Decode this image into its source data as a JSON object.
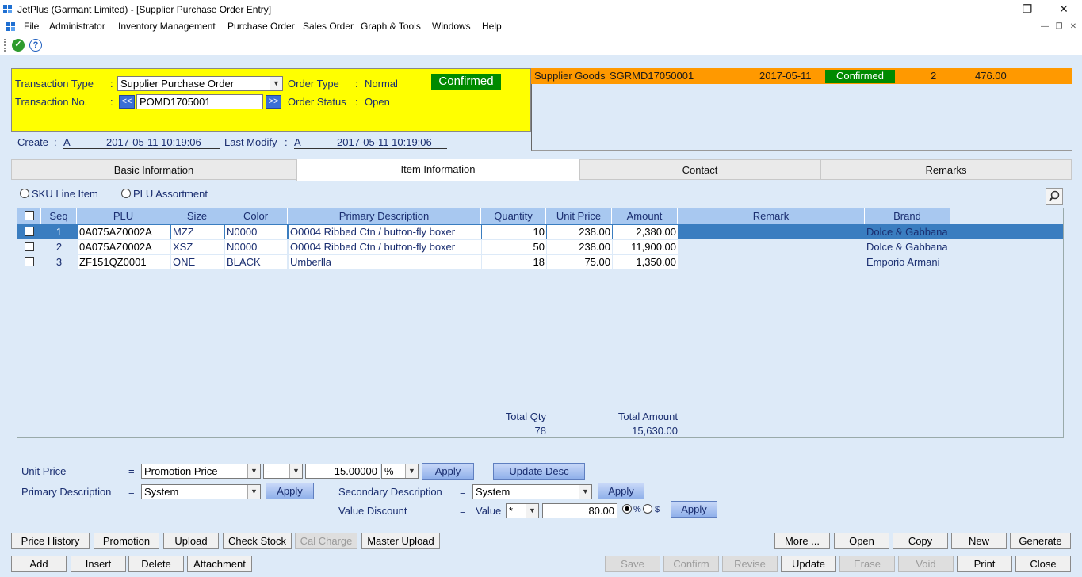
{
  "window": {
    "title": "JetPlus (Garmant Limited) - [Supplier Purchase Order Entry]",
    "min": "—",
    "restore": "❐",
    "close": "✕"
  },
  "menu": [
    "File",
    "Administrator",
    "Inventory Management",
    "Purchase Order",
    "Sales Order",
    "Graph & Tools",
    "Windows",
    "Help"
  ],
  "mdi": {
    "min": "—",
    "restore": "❐",
    "close": "✕"
  },
  "header": {
    "transaction_type_label": "Transaction Type",
    "transaction_type_value": "Supplier Purchase Order",
    "order_type_label": "Order Type",
    "order_type_value": "Normal",
    "status_badge": "Confirmed",
    "transaction_no_label": "Transaction No.",
    "transaction_no_value": "POMD1705001",
    "prev": "<<",
    "next": ">>",
    "order_status_label": "Order Status",
    "order_status_value": "Open",
    "colon": ":",
    "create_label": "Create",
    "create_user": "A",
    "create_time": "2017-05-11 10:19:06",
    "modify_label": "Last Modify",
    "modify_user": "A",
    "modify_time": "2017-05-11 10:19:06"
  },
  "related": {
    "type": "Supplier Goods",
    "doc_no": "SGRMD17050001",
    "date": "2017-05-11",
    "status": "Confirmed",
    "qty": "2",
    "amount": "476.00"
  },
  "tabs": [
    "Basic Information",
    "Item Information",
    "Contact",
    "Remarks"
  ],
  "view_options": {
    "sku": "SKU Line Item",
    "plu": "PLU Assortment"
  },
  "grid": {
    "columns": [
      "Seq",
      "PLU",
      "Size",
      "Color",
      "Primary Description",
      "Quantity",
      "Unit Price",
      "Amount",
      "Remark",
      "Brand"
    ],
    "rows": [
      {
        "seq": "1",
        "plu": "0A075AZ0002A",
        "size": "MZZ",
        "color": "N0000",
        "desc": "O0004   Ribbed Ctn / button-fly boxer",
        "qty": "10",
        "price": "238.00",
        "amount": "2,380.00",
        "remark": "",
        "brand": "Dolce & Gabbana"
      },
      {
        "seq": "2",
        "plu": "0A075AZ0002A",
        "size": "XSZ",
        "color": "N0000",
        "desc": "O0004   Ribbed Ctn / button-fly boxer",
        "qty": "50",
        "price": "238.00",
        "amount": "11,900.00",
        "remark": "",
        "brand": "Dolce & Gabbana"
      },
      {
        "seq": "3",
        "plu": "ZF151QZ0001",
        "size": "ONE",
        "color": "BLACK",
        "desc": "Umberlla",
        "qty": "18",
        "price": "75.00",
        "amount": "1,350.00",
        "remark": "",
        "brand": "Emporio Armani"
      }
    ],
    "total_qty_label": "Total Qty",
    "total_qty": "78",
    "total_amount_label": "Total Amount",
    "total_amount": "15,630.00"
  },
  "bulk": {
    "unit_price_label": "Unit Price",
    "eq": "=",
    "unit_price_mode": "Promotion Price",
    "op": "-",
    "unit_price_value": "15.00000",
    "unit": "%",
    "apply": "Apply",
    "update_desc": "Update Desc",
    "primary_desc_label": "Primary Description",
    "primary_desc_value": "System",
    "secondary_desc_label": "Secondary Description",
    "secondary_desc_value": "System",
    "value_discount_label": "Value Discount",
    "value_label": "Value",
    "value_op": "*",
    "value_amount": "80.00",
    "pct": "%",
    "dollar": "$"
  },
  "buttons_row1": [
    "Price History",
    "Promotion",
    "Upload",
    "Check Stock",
    "Cal Charge",
    "Master Upload"
  ],
  "buttons_row1_right": [
    "More ...",
    "Open",
    "Copy",
    "New",
    "Generate"
  ],
  "buttons_row2": [
    "Add",
    "Insert",
    "Delete",
    "Attachment"
  ],
  "buttons_row2_right": [
    "Save",
    "Confirm",
    "Revise",
    "Update",
    "Erase",
    "Void",
    "Print",
    "Close"
  ]
}
